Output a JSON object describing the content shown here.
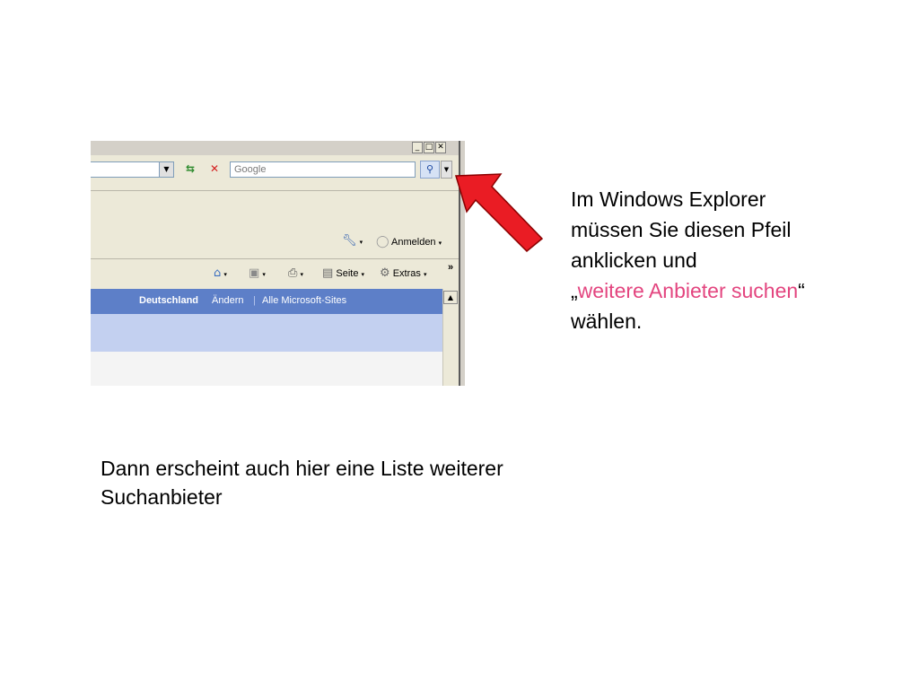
{
  "browser": {
    "window_controls": {
      "minimize": "_",
      "maximize": "□",
      "close": "✕"
    },
    "search": {
      "placeholder": "Google"
    },
    "toolbar": {
      "signin_label": "Anmelden",
      "page_label": "Seite",
      "tools_label": "Extras",
      "overflow": "»",
      "caret": "▾"
    },
    "page": {
      "country": "Deutschland",
      "change": "Ändern",
      "separator": "|",
      "all_sites": "Alle Microsoft-Sites"
    },
    "icons": [
      "refresh-icon",
      "stop-icon",
      "search-icon",
      "wrench-icon",
      "home-icon",
      "feeds-icon",
      "print-icon",
      "page-icon",
      "gear-icon"
    ],
    "colors": {
      "header_blue": "#5d7fc8",
      "body_blue": "#c3d0f0",
      "chrome": "#ece9d8"
    }
  },
  "instructions": {
    "line1": "Im Windows Explorer",
    "line2": "müssen Sie diesen Pfeil",
    "line3": "anklicken und",
    "quote_open": "„",
    "highlight": "weitere Anbieter suchen",
    "quote_close": "“",
    "line5": "wählen."
  },
  "note": {
    "line1": "Dann erscheint auch hier eine Liste weiterer",
    "line2": "Suchanbieter"
  },
  "colors": {
    "arrow_red": "#ea1c24",
    "highlight_pink": "#e3457f"
  }
}
